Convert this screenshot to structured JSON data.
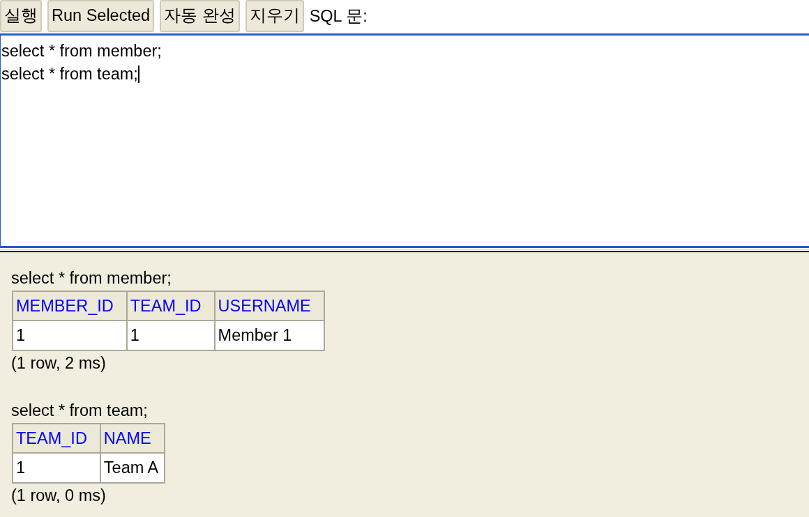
{
  "toolbar": {
    "buttons": [
      "실행",
      "Run Selected",
      "자동 완성",
      "지우기"
    ],
    "label": "SQL 문:"
  },
  "editor": {
    "focused": true,
    "lines": [
      "select * from member;",
      "select * from team;"
    ]
  },
  "results": [
    {
      "query": "select * from member;",
      "columns": [
        "MEMBER_ID",
        "TEAM_ID",
        "USERNAME"
      ],
      "rows": [
        [
          "1",
          "1",
          "Member 1"
        ]
      ],
      "summary": "(1 row, 2 ms)"
    },
    {
      "query": "select * from team;",
      "columns": [
        "TEAM_ID",
        "NAME"
      ],
      "rows": [
        [
          "1",
          "Team A"
        ]
      ],
      "summary": "(1 row, 0 ms)"
    }
  ]
}
